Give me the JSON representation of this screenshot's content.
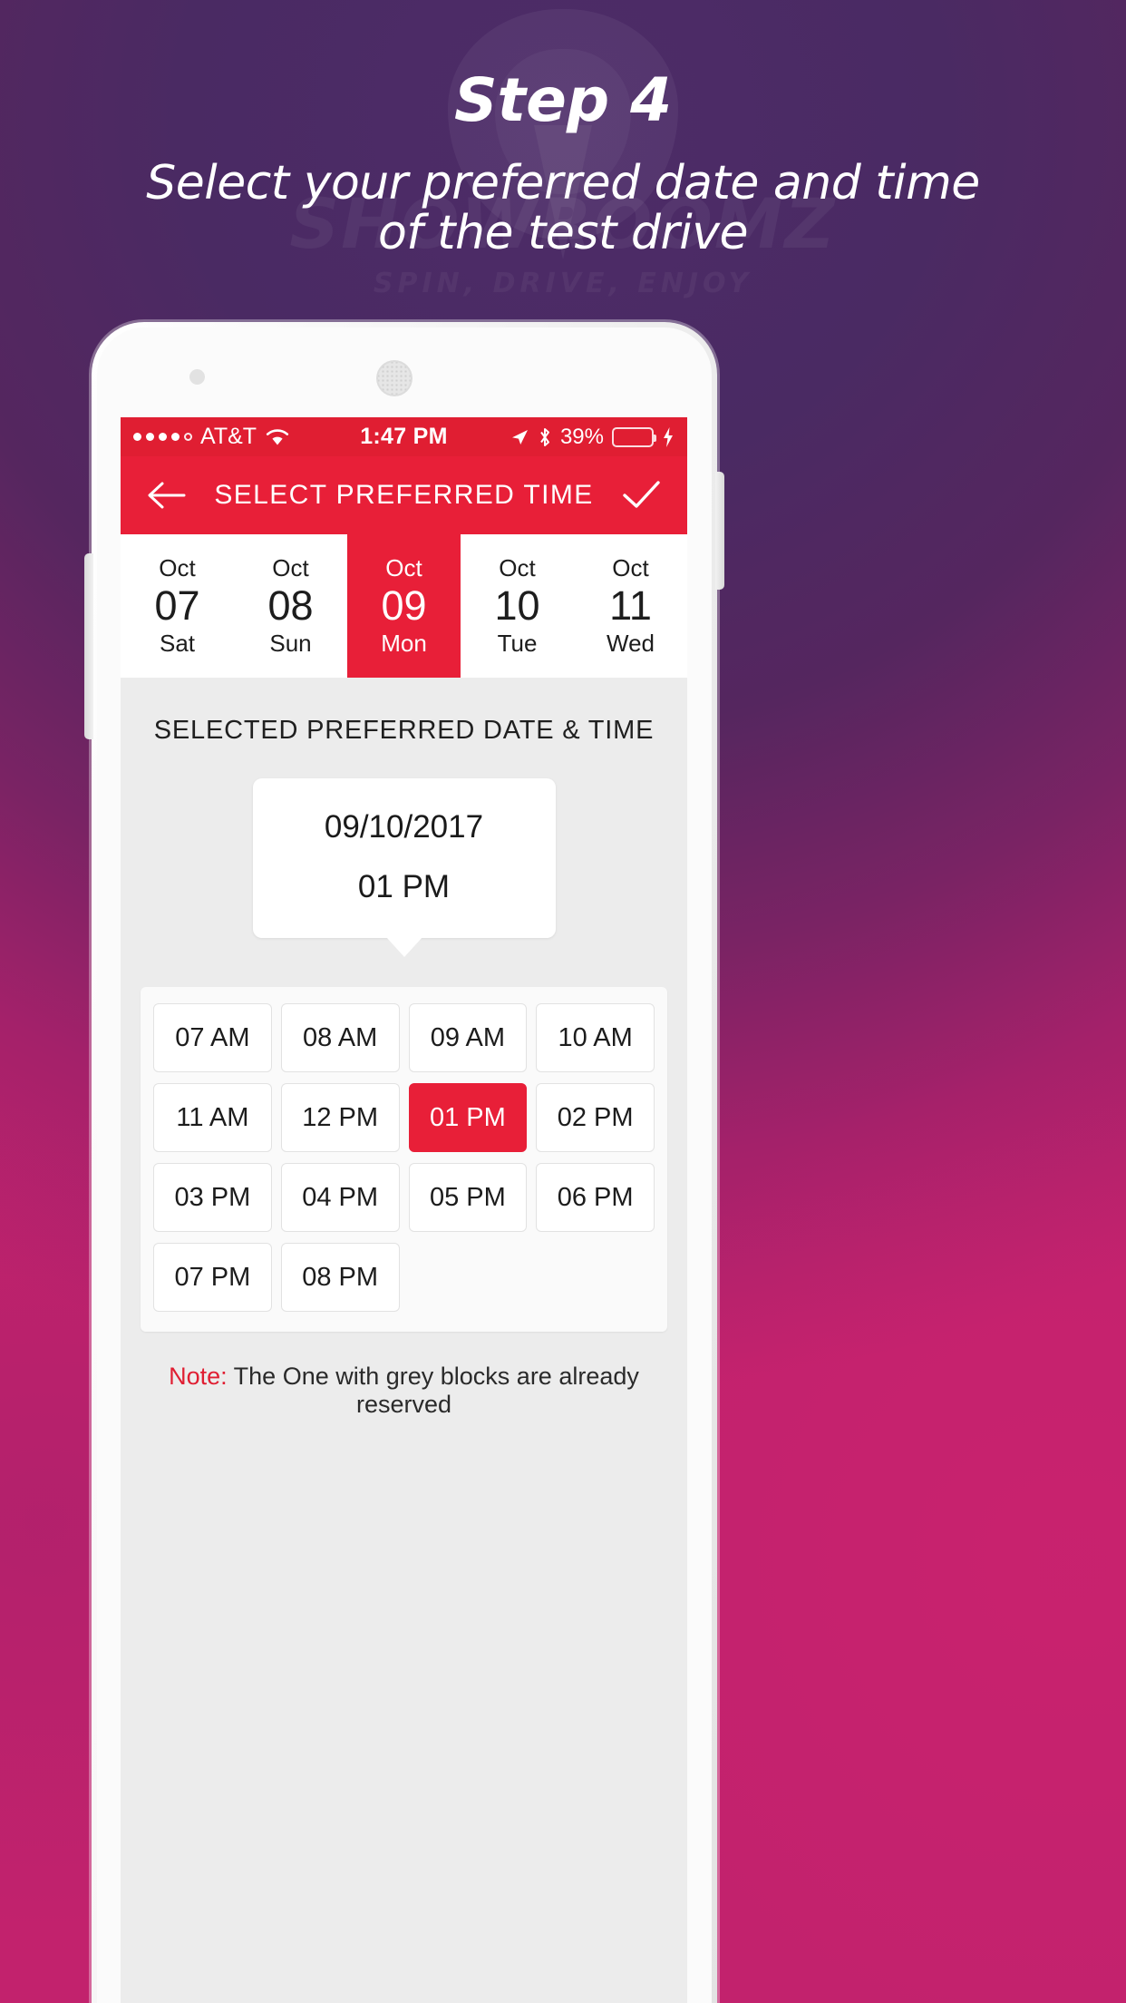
{
  "promo": {
    "step_title": "Step 4",
    "subtitle_line1": "Select your preferred date and time",
    "subtitle_line2": "of the test drive",
    "watermark_brand": "SHOWROOMZ",
    "watermark_tagline": "SPIN, DRIVE, ENJOY",
    "background_from": "#4a2a63",
    "background_to": "#c2226d"
  },
  "status_bar": {
    "carrier": "AT&T",
    "time": "1:47 PM",
    "battery_percent": "39%",
    "signal_dots_filled": 4,
    "signal_dots_total": 5,
    "icons": [
      "wifi-icon",
      "location-arrow-icon",
      "bluetooth-icon",
      "battery-icon",
      "charging-bolt-icon"
    ],
    "background": "#e01e32"
  },
  "app_bar": {
    "title": "SELECT PREFERRED TIME",
    "back_icon": "arrow-left-icon",
    "confirm_icon": "check-icon",
    "background": "#e81f38"
  },
  "date_strip": [
    {
      "month": "Oct",
      "day": "07",
      "weekday": "Sat",
      "selected": false
    },
    {
      "month": "Oct",
      "day": "08",
      "weekday": "Sun",
      "selected": false
    },
    {
      "month": "Oct",
      "day": "09",
      "weekday": "Mon",
      "selected": true
    },
    {
      "month": "Oct",
      "day": "10",
      "weekday": "Tue",
      "selected": false
    },
    {
      "month": "Oct",
      "day": "11",
      "weekday": "Wed",
      "selected": false
    }
  ],
  "selection": {
    "heading": "SELECTED PREFERRED DATE & TIME",
    "date": "09/10/2017",
    "time": "01 PM"
  },
  "time_slots": [
    {
      "label": "07 AM",
      "selected": false
    },
    {
      "label": "08 AM",
      "selected": false
    },
    {
      "label": "09 AM",
      "selected": false
    },
    {
      "label": "10 AM",
      "selected": false
    },
    {
      "label": "11 AM",
      "selected": false
    },
    {
      "label": "12 PM",
      "selected": false
    },
    {
      "label": "01 PM",
      "selected": true
    },
    {
      "label": "02 PM",
      "selected": false
    },
    {
      "label": "03 PM",
      "selected": false
    },
    {
      "label": "04 PM",
      "selected": false
    },
    {
      "label": "05 PM",
      "selected": false
    },
    {
      "label": "06 PM",
      "selected": false
    },
    {
      "label": "07 PM",
      "selected": false
    },
    {
      "label": "08 PM",
      "selected": false
    }
  ],
  "footer_note": {
    "label": "Note:",
    "text": " The One with grey blocks are already reserved",
    "label_color": "#e01e32"
  }
}
